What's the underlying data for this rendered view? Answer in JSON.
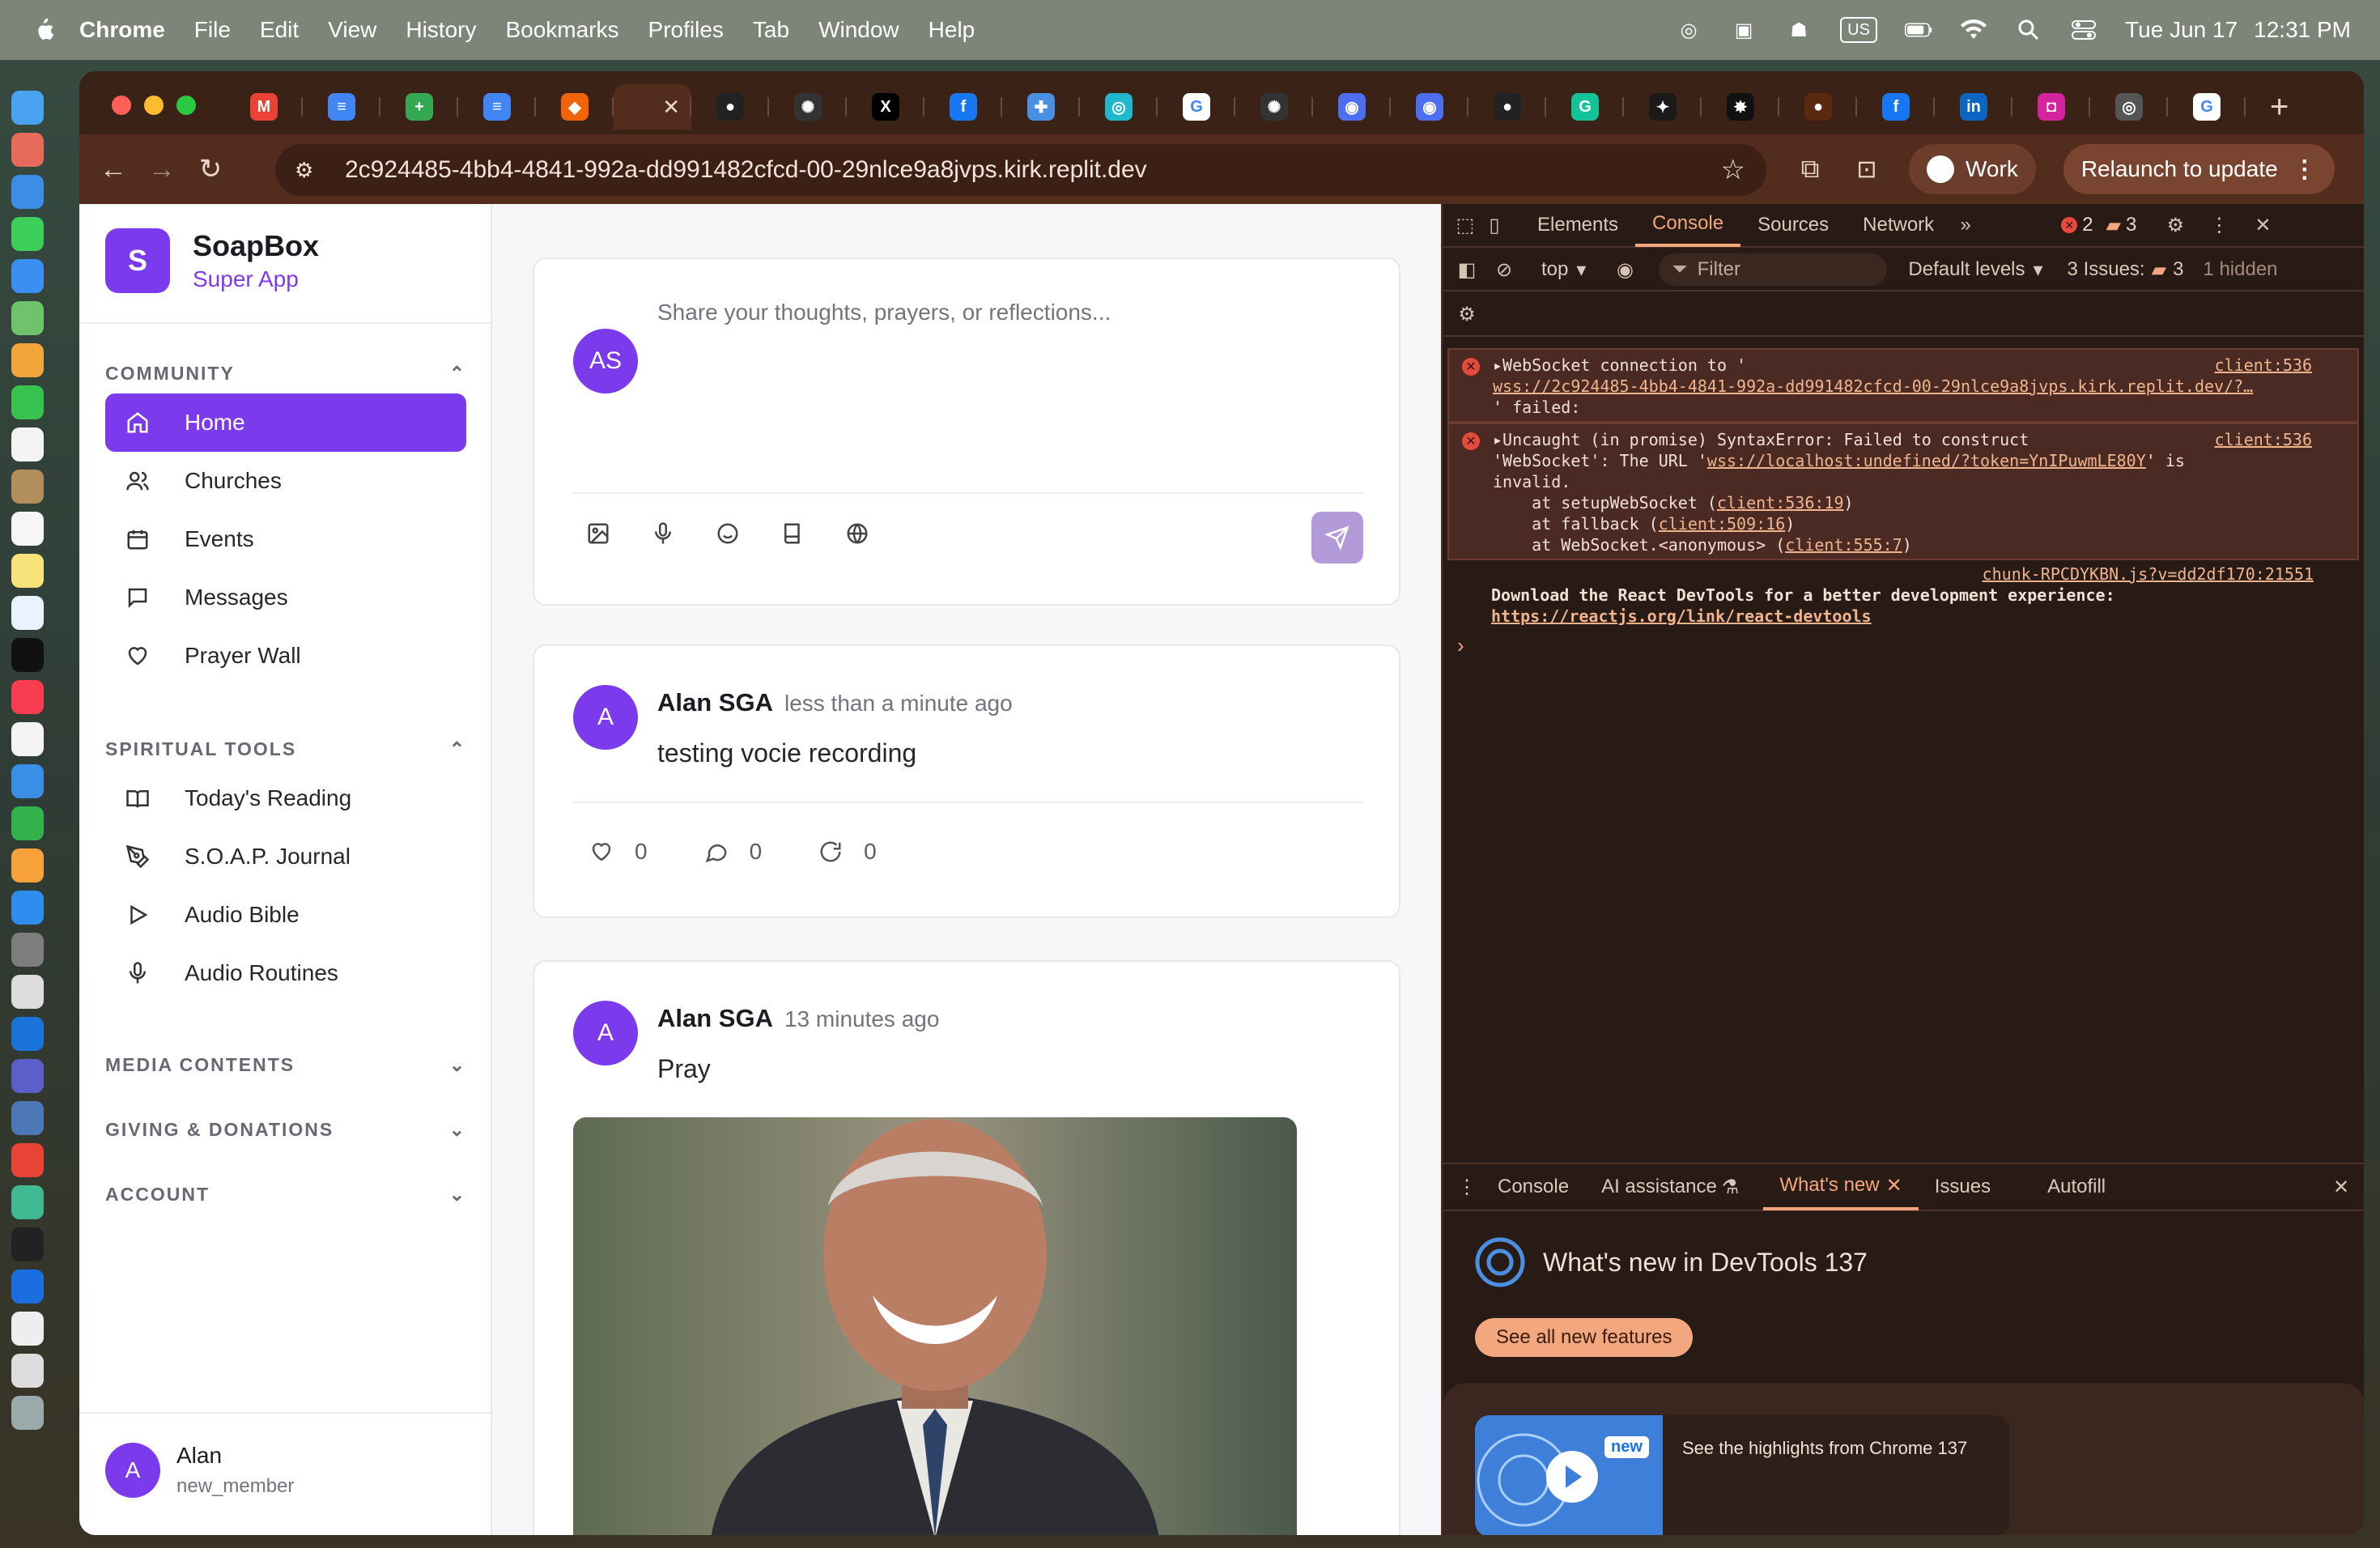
{
  "menubar": {
    "app": "Chrome",
    "items": [
      "File",
      "Edit",
      "View",
      "History",
      "Bookmarks",
      "Profiles",
      "Tab",
      "Window",
      "Help"
    ],
    "input_source": "US",
    "date": "Tue Jun 17",
    "time": "12:31 PM"
  },
  "tabs": {
    "items": [
      {
        "icon": "gmail-icon",
        "letter": "M",
        "color": "#ea4335"
      },
      {
        "icon": "google-docs-icon",
        "letter": "≡",
        "color": "#4285f4"
      },
      {
        "icon": "google-sheets-icon",
        "letter": "+",
        "color": "#34a853"
      },
      {
        "icon": "google-docs-icon",
        "letter": "≡",
        "color": "#4285f4"
      },
      {
        "icon": "replit-icon",
        "letter": "◆",
        "color": "#f26207"
      },
      {
        "icon": "active-tab-icon",
        "letter": "",
        "color": "#522c1d"
      },
      {
        "icon": "github-icon",
        "letter": "●",
        "color": "#222222"
      },
      {
        "icon": "openai-icon",
        "letter": "✺",
        "color": "#333333"
      },
      {
        "icon": "x-icon",
        "letter": "X",
        "color": "#000000"
      },
      {
        "icon": "facebook-icon",
        "letter": "f",
        "color": "#1877f2"
      },
      {
        "icon": "puzzle-icon",
        "letter": "✚",
        "color": "#4a90e2"
      },
      {
        "icon": "perplexity-icon",
        "letter": "◎",
        "color": "#20b8cd"
      },
      {
        "icon": "google-icon",
        "letter": "G",
        "color": "#ffffff"
      },
      {
        "icon": "openai-icon",
        "letter": "✺",
        "color": "#333333"
      },
      {
        "icon": "chrome-web-icon",
        "letter": "◉",
        "color": "#4e6ef2"
      },
      {
        "icon": "chrome-web-icon",
        "letter": "◉",
        "color": "#4e6ef2"
      },
      {
        "icon": "github-icon",
        "letter": "●",
        "color": "#222222"
      },
      {
        "icon": "grammarly-icon",
        "letter": "G",
        "color": "#15c39a"
      },
      {
        "icon": "pinterest-icon",
        "letter": "✦",
        "color": "#1a1a1a"
      },
      {
        "icon": "bug-icon",
        "letter": "✸",
        "color": "#111111"
      },
      {
        "icon": "profile-circle-icon",
        "letter": "●",
        "color": "#5a2a10"
      },
      {
        "icon": "facebook-icon",
        "letter": "f",
        "color": "#1877f2"
      },
      {
        "icon": "linkedin-icon",
        "letter": "in",
        "color": "#0a66c2"
      },
      {
        "icon": "instagram-icon",
        "letter": "◘",
        "color": "#d6249f"
      },
      {
        "icon": "chatgpt-icon",
        "letter": "◎",
        "color": "#555555"
      },
      {
        "icon": "google-icon",
        "letter": "G",
        "color": "#ffffff"
      }
    ],
    "new_tab": "+"
  },
  "toolbar": {
    "url": "2c924485-4bb4-4841-992a-dd991482cfcd-00-29nlce9a8jvps.kirk.replit.dev",
    "profile": "Work",
    "relaunch": "Relaunch to update"
  },
  "app": {
    "brand": {
      "logo_letter": "S",
      "name": "SoapBox",
      "subtitle": "Super App"
    },
    "sections": {
      "community": "COMMUNITY",
      "spiritual_tools": "SPIRITUAL TOOLS",
      "media": "MEDIA CONTENTS",
      "giving": "GIVING & DONATIONS",
      "account": "ACCOUNT"
    },
    "community_items": [
      "Home",
      "Churches",
      "Events",
      "Messages",
      "Prayer Wall"
    ],
    "tools_items": [
      "Today's Reading",
      "S.O.A.P. Journal",
      "Audio Bible",
      "Audio Routines"
    ],
    "user": {
      "initial": "A",
      "name": "Alan",
      "role": "new_member"
    },
    "compose": {
      "initials": "AS",
      "placeholder": "Share your thoughts, prayers, or reflections..."
    },
    "posts": [
      {
        "initial": "A",
        "author": "Alan SGA",
        "time": "less than a minute ago",
        "text": "testing vocie recording",
        "likes": "0",
        "comments": "0",
        "shares": "0"
      },
      {
        "initial": "A",
        "author": "Alan SGA",
        "time": "13 minutes ago",
        "text": "Pray"
      }
    ]
  },
  "devtools": {
    "tabs": [
      "Elements",
      "Console",
      "Sources",
      "Network"
    ],
    "active_tab": "Console",
    "error_count": "2",
    "issue_count": "3",
    "context": "top",
    "filter": "Filter",
    "levels": "Default levels",
    "issues_label": "3 Issues:",
    "issues_num": "3",
    "hidden": "1 hidden",
    "messages": {
      "m1_line1": "WebSocket connection to '",
      "m1_link": "wss://2c924485-4bb4-4841-992a-dd991482cfcd-00-29nlce9a8jvps.kirk.replit.dev/?…",
      "m1_line3": "' failed:",
      "m1_src": "client:536",
      "m2_line1": "Uncaught (in promise) SyntaxError: Failed to construct",
      "m2_line2a": "'WebSocket': The URL '",
      "m2_link": "wss://localhost:undefined/?token=YnIPuwmLE80Y",
      "m2_line2b": "' is",
      "m2_line3": "invalid.",
      "m2_at1": "    at setupWebSocket (",
      "m2_at1_link": "client:536:19",
      "m2_at2": "    at fallback (",
      "m2_at2_link": "client:509:16",
      "m2_at3": "    at WebSocket.<anonymous> (",
      "m2_at3_link": "client:555:7",
      "m2_src": "client:536",
      "m3_src": "chunk-RPCDYKBN.js?v=dd2df170:21551",
      "m3_line1": "Download the React DevTools for a better development experience:",
      "m3_link": "https://reactjs.org/link/react-devtools",
      "prompt": "›"
    },
    "drawer": {
      "tabs": [
        "Console",
        "AI assistance",
        "What's new",
        "Issues",
        "Autofill"
      ],
      "active": "What's new",
      "title": "What's new in DevTools 137",
      "button": "See all new features",
      "badge": "new",
      "highlight": "See the highlights from Chrome 137"
    }
  }
}
